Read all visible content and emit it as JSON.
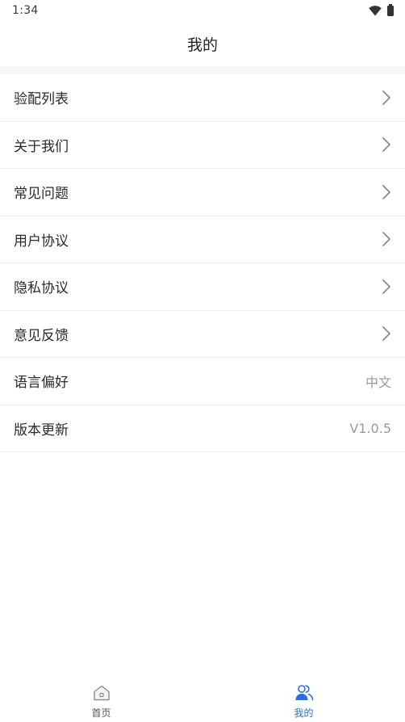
{
  "status_bar": {
    "time": "1:34",
    "icons": [
      "wifi-icon",
      "battery-icon"
    ]
  },
  "header": {
    "title": "我的"
  },
  "menu": {
    "items": [
      {
        "label": "验配列表",
        "trailing": "chevron-right-icon"
      },
      {
        "label": "关于我们",
        "trailing": "chevron-right-icon"
      },
      {
        "label": "常见问题",
        "trailing": "chevron-right-icon"
      },
      {
        "label": "用户协议",
        "trailing": "chevron-right-icon"
      },
      {
        "label": "隐私协议",
        "trailing": "chevron-right-icon"
      },
      {
        "label": "意见反馈",
        "trailing": "chevron-right-icon"
      },
      {
        "label": "语言偏好",
        "value": "中文"
      },
      {
        "label": "版本更新",
        "value": "V1.0.5"
      }
    ]
  },
  "tab_bar": {
    "tabs": [
      {
        "label": "首页",
        "icon": "home-icon",
        "active": false
      },
      {
        "label": "我的",
        "icon": "users-icon",
        "active": true
      }
    ],
    "active_color": "#2f6fd3",
    "inactive_color": "#555555"
  }
}
